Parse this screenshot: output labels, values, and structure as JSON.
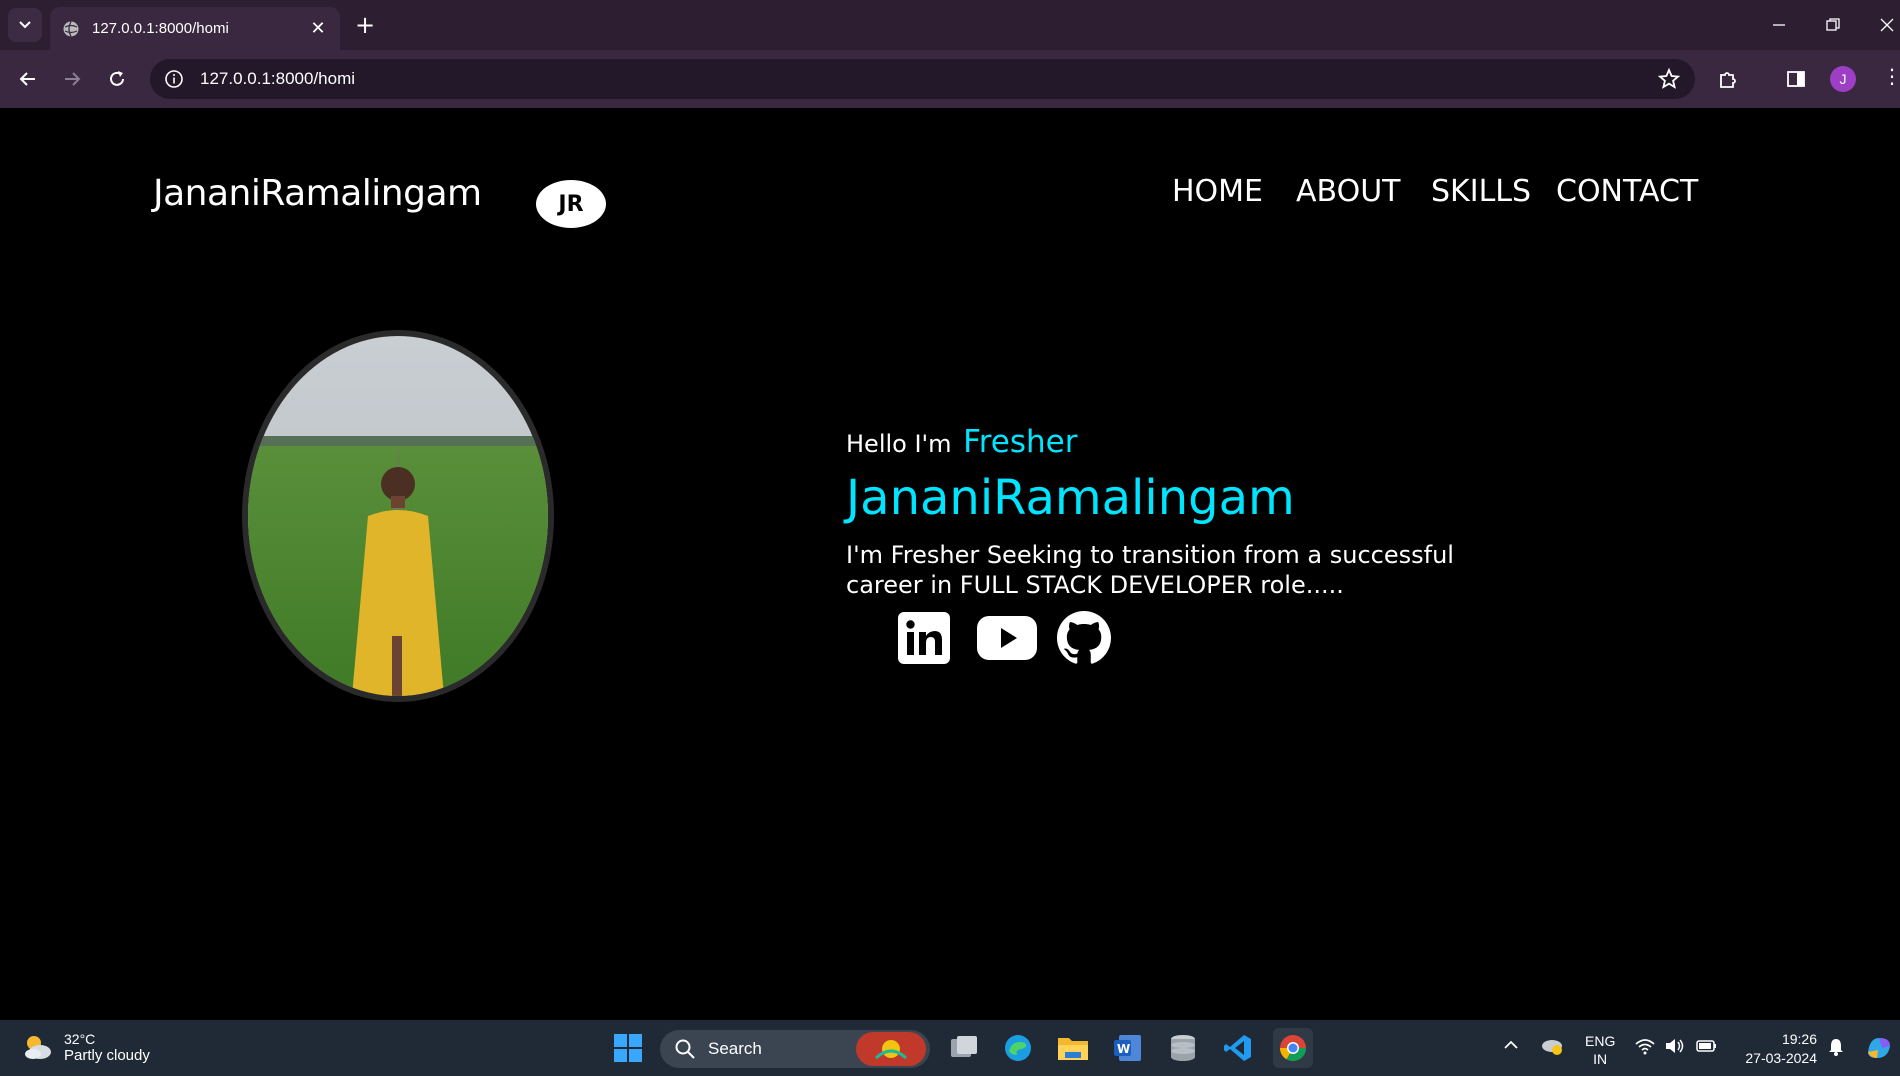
{
  "browser": {
    "tab_title": "127.0.0.1:8000/homi",
    "url": "127.0.0.1:8000/homi",
    "profile_initial": "J"
  },
  "site": {
    "logo_text": "JananiRamalingam",
    "badge_text": "JR",
    "nav": [
      "HOME",
      "ABOUT",
      "SKILLS",
      "CONTACT"
    ],
    "hello_prefix": "Hello I'm",
    "role": "Fresher",
    "name": "JananiRamalingam",
    "bio_line1": "I'm Fresher Seeking to transition from a successful",
    "bio_line2": "career in FULL STACK DEVELOPER role.....",
    "social_icons": [
      "linkedin-icon",
      "youtube-icon",
      "github-icon"
    ]
  },
  "taskbar": {
    "temperature": "32°C",
    "weather": "Partly cloudy",
    "search_label": "Search",
    "lang_line1": "ENG",
    "lang_line2": "IN",
    "time": "19:26",
    "date": "27-03-2024"
  },
  "colors": {
    "accent": "#00e5ff",
    "page_bg": "#000000",
    "chrome_tab": "#3a2840"
  }
}
